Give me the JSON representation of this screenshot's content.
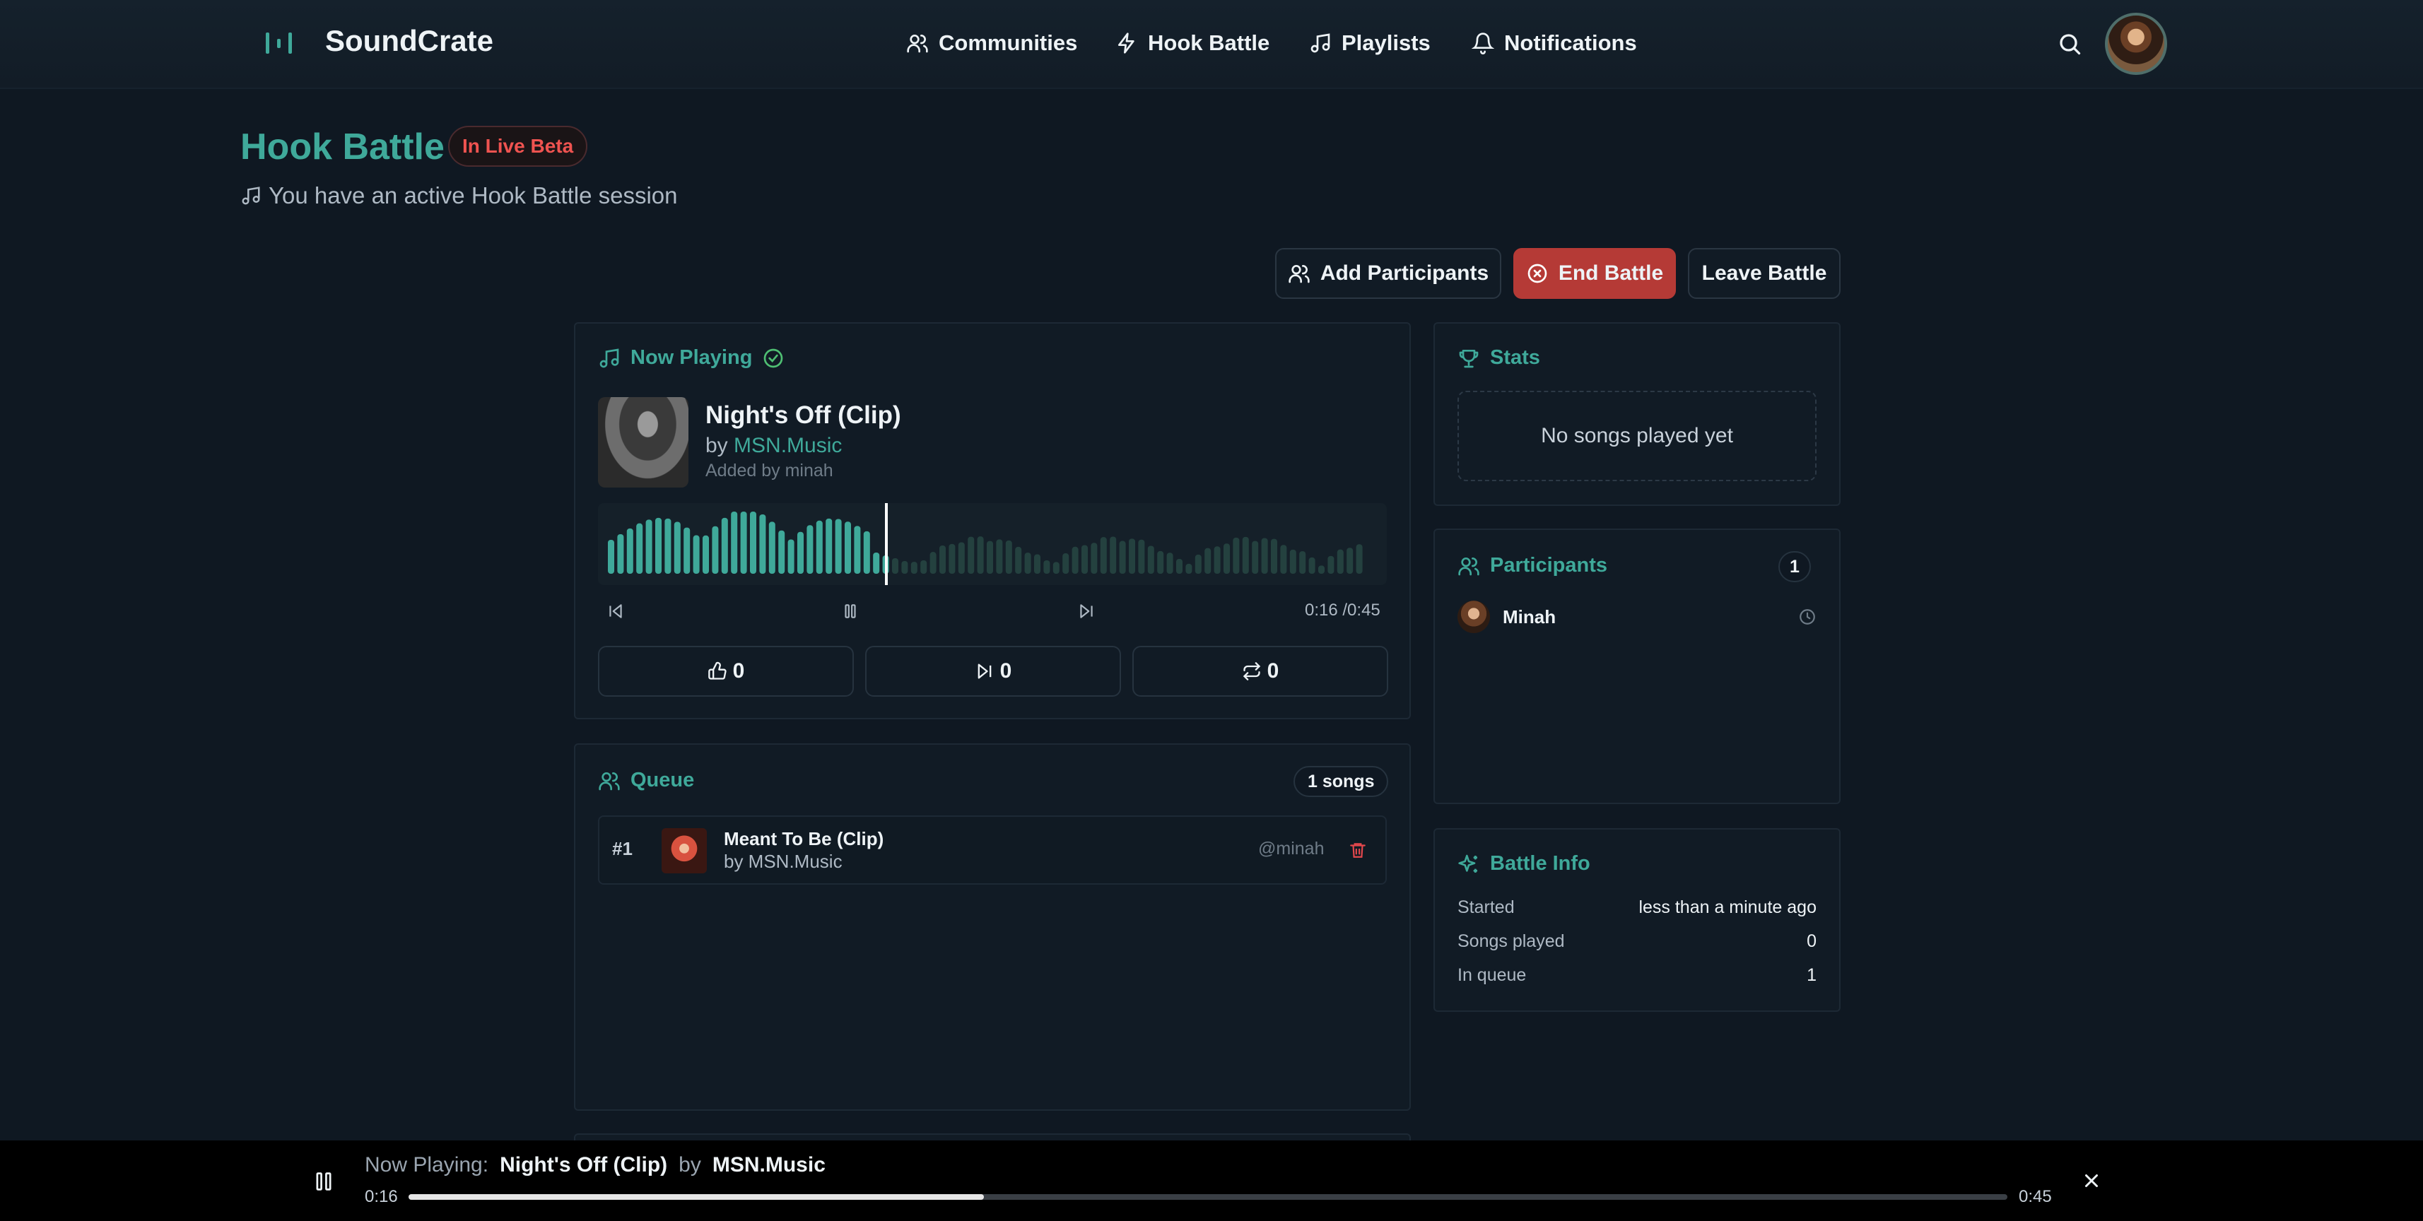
{
  "brand": {
    "name": "SoundCrate"
  },
  "nav": {
    "communities": "Communities",
    "hook_battle": "Hook Battle",
    "playlists": "Playlists",
    "notifications": "Notifications"
  },
  "page": {
    "title": "Hook Battle",
    "badge": "In Live Beta",
    "session": "You have an active Hook Battle session"
  },
  "actions": {
    "add": "Add Participants",
    "end": "End Battle",
    "leave": "Leave Battle"
  },
  "now_playing": {
    "heading": "Now Playing",
    "title": "Night's Off (Clip)",
    "by": "by",
    "artist": "MSN.Music",
    "added_by": "Added by minah",
    "time": "0:16 /0:45",
    "progress": 0.36,
    "likes": "0",
    "skips": "0",
    "replays": "0"
  },
  "queue": {
    "heading": "Queue",
    "count": "1 songs",
    "items": [
      {
        "num": "#1",
        "title": "Meant To Be (Clip)",
        "by": "by MSN.Music",
        "user": "@minah"
      }
    ]
  },
  "stats": {
    "heading": "Stats",
    "empty": "No songs played yet"
  },
  "participants": {
    "heading": "Participants",
    "count": "1",
    "list": [
      {
        "name": "Minah"
      }
    ]
  },
  "battle_info": {
    "heading": "Battle Info",
    "rows": [
      {
        "label": "Started",
        "value": "less than a minute ago"
      },
      {
        "label": "Songs played",
        "value": "0"
      },
      {
        "label": "In queue",
        "value": "1"
      }
    ]
  },
  "footer_player": {
    "label": "Now Playing:",
    "title": "Night's Off (Clip)",
    "by": "by",
    "artist": "MSN.Music",
    "current": "0:16",
    "total": "0:45",
    "progress": 0.36
  },
  "colors": {
    "accent": "#3fa99a",
    "danger": "#b53a36",
    "beta": "#ef5350",
    "background": "#0f1822"
  },
  "icons": [
    "logo-icon",
    "users-icon",
    "bolt-icon",
    "music-note-icon",
    "bell-icon",
    "search-icon",
    "check-circle-icon",
    "skip-back-icon",
    "pause-icon",
    "skip-forward-icon",
    "thumbs-up-icon",
    "skip-icon",
    "repeat-icon",
    "trash-icon",
    "trophy-icon",
    "clock-icon",
    "sparkles-icon",
    "close-icon",
    "x-circle-icon"
  ]
}
